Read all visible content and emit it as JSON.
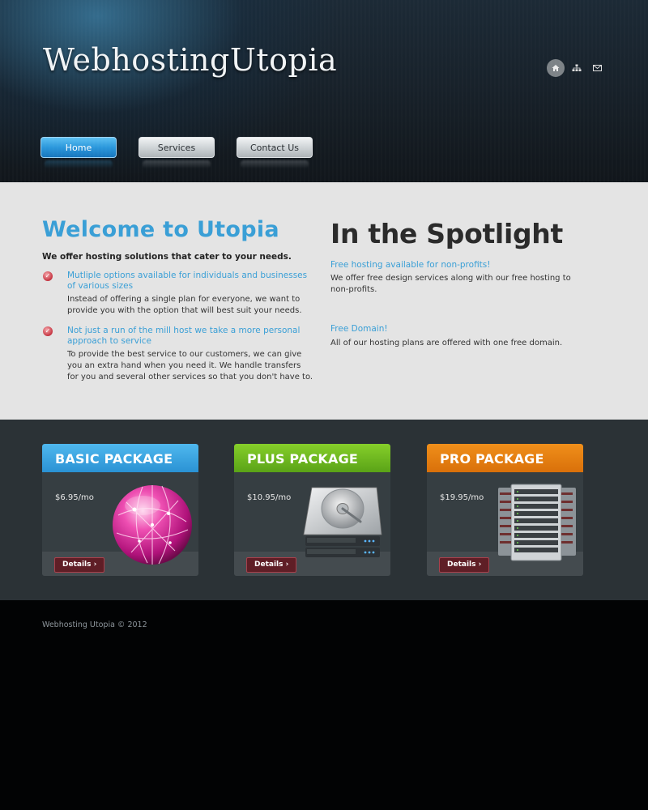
{
  "header": {
    "logo": "WebhostingUtopia",
    "icons": [
      "home-icon",
      "sitemap-icon",
      "mail-icon"
    ],
    "nav": [
      {
        "label": "Home",
        "active": true
      },
      {
        "label": "Services",
        "active": false
      },
      {
        "label": "Contact Us",
        "active": false
      }
    ]
  },
  "welcome": {
    "title": "Welcome to Utopia",
    "subtitle": "We offer hosting solutions that cater to your needs.",
    "features": [
      {
        "icon": "check-icon",
        "title": "Mutliple options available for individuals and businesses of various sizes",
        "body": "Instead of offering a single plan for everyone, we want to provide you with the option that will best suit your needs."
      },
      {
        "icon": "check-icon",
        "title": "Not just a run of the mill host we take a more personal approach to service",
        "body": "To provide the best service to our customers, we can give you an extra hand when you need it. We handle transfers for you and several other services so that you don't have to."
      }
    ]
  },
  "spotlight": {
    "title": "In the Spotlight",
    "items": [
      {
        "heading": "Free hosting available for non-profits!",
        "body": "We offer free design services along with our free hosting to non-profits."
      },
      {
        "heading": "Free Domain!",
        "body": "All of our hosting plans are offered with one free domain."
      }
    ]
  },
  "packages": [
    {
      "name": "BASIC PACKAGE",
      "price": "$6.95/mo",
      "button": "Details ›",
      "color": "#3aa6e3",
      "image": "globe-icon"
    },
    {
      "name": "PLUS PACKAGE",
      "price": "$10.95/mo",
      "button": "Details ›",
      "color": "#6cbb1f",
      "image": "hard-drive-icon"
    },
    {
      "name": "PRO PACKAGE",
      "price": "$19.95/mo",
      "button": "Details ›",
      "color": "#e7810f",
      "image": "server-rack-icon"
    }
  ],
  "footer": {
    "text": "Webhosting Utopia © 2012"
  },
  "colors": {
    "accent_blue": "#3a9fd6",
    "main_bg": "#e4e4e4",
    "packages_bg": "#2b3236",
    "footer_bg": "#020304"
  }
}
